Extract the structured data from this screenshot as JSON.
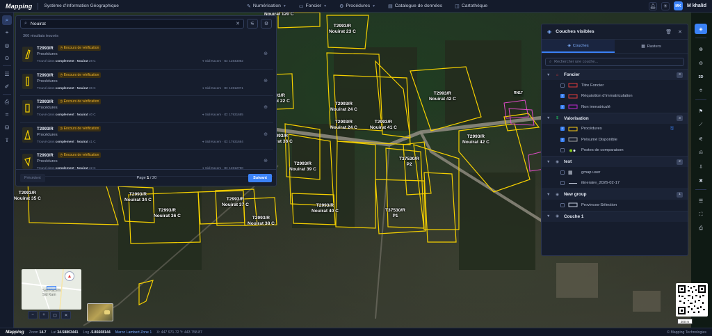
{
  "app": {
    "logo": "Mapping",
    "title": "Système d'Information Géographique"
  },
  "nav": [
    {
      "label": "Numérisation",
      "icon": "pen-icon",
      "has_dropdown": true
    },
    {
      "label": "Foncier",
      "icon": "folder-icon",
      "has_dropdown": true
    },
    {
      "label": "Procédures",
      "icon": "gear-icon",
      "has_dropdown": true
    },
    {
      "label": "Catalogue de données",
      "icon": "catalog-icon",
      "has_dropdown": false
    },
    {
      "label": "Cartothèque",
      "icon": "map-book-icon",
      "has_dropdown": false
    }
  ],
  "user": {
    "initials": "MK",
    "name": "M khalid"
  },
  "search": {
    "query": "Nouirat",
    "result_count": "366 résultats trouvés",
    "results": [
      {
        "title": "T2993/R",
        "badge": "Encours de vérification",
        "type": "Procédures",
        "found_in": "Trouvé dans",
        "field": "complement",
        "match": "Nouirat",
        "rest": "28 C",
        "location": "Sidi Kacem",
        "id": "ID: 12843082"
      },
      {
        "title": "T2993/R",
        "badge": "Encours de vérification",
        "type": "Procédures",
        "found_in": "Trouvé dans",
        "field": "complement",
        "match": "Nouirat",
        "rest": "36 C",
        "location": "Sidi Kacem",
        "id": "ID: 12812071"
      },
      {
        "title": "T2993/R",
        "badge": "Encours de vérification",
        "type": "Procédures",
        "found_in": "Trouvé dans",
        "field": "complement",
        "match": "Nouirat",
        "rest": "40 C",
        "location": "Sidi Kacem",
        "id": "ID: 17931685"
      },
      {
        "title": "T2993/R",
        "badge": "Encours de vérification",
        "type": "Procédures",
        "found_in": "Trouvé dans",
        "field": "complement",
        "match": "Nouirat",
        "rest": "41 C",
        "location": "Sidi Kacem",
        "id": "ID: 17931684"
      },
      {
        "title": "T2993/R",
        "badge": "Encours de vérification",
        "type": "Procédures",
        "found_in": "Trouvé dans",
        "field": "complement",
        "match": "Nouirat",
        "rest": "42 C",
        "location": "Sidi Kacem",
        "id": "ID: 12812790"
      }
    ],
    "pager": {
      "prev": "Précédent",
      "page_word": "Page",
      "current": "1",
      "total": "/ 20",
      "next": "Suivant"
    }
  },
  "layers": {
    "title": "Couches visibles",
    "tabs": [
      "Couches",
      "Rasters"
    ],
    "search_placeholder": "Rechercher une couche...",
    "groups": [
      {
        "name": "Foncier",
        "count": "3",
        "icon_color": "#e23b3b",
        "items": [
          {
            "name": "Titre Foncier",
            "checked": false,
            "color": "#e23b3b"
          },
          {
            "name": "Réquisition d'immatriculation",
            "checked": true,
            "color": "#e23b3b"
          },
          {
            "name": "Non immatriculé",
            "checked": true,
            "color": "#c026d3"
          }
        ]
      },
      {
        "name": "Valorisation",
        "count": "3",
        "icon_color": "#22c55e",
        "items": [
          {
            "name": "Procédures",
            "checked": true,
            "color": "#facc15"
          },
          {
            "name": "Présumé Disponible",
            "checked": true,
            "color": "#a3a3a3"
          },
          {
            "name": "Postes de comparaison",
            "checked": false,
            "color": "#84cc16"
          }
        ]
      },
      {
        "name": "test",
        "count": "2",
        "icon_color": "#8a96b3",
        "items": [
          {
            "name": "gmap user",
            "checked": false,
            "color": "#c7cede"
          },
          {
            "name": "itineraire_2026-02-17",
            "checked": false,
            "color": "#c7cede"
          }
        ]
      },
      {
        "name": "New group",
        "count": "1",
        "icon_color": "#8a96b3",
        "items": [
          {
            "name": "Provinces-Sélection",
            "checked": false,
            "color": "#c7cede"
          }
        ]
      },
      {
        "name": "Couche 1",
        "count": "",
        "icon_color": "#8a96b3",
        "items": []
      }
    ]
  },
  "parcels": [
    "T2993/R Nouirat 23 C",
    "T2993/R Nouirat 22 C",
    "T2993/R Nouirat 24 C",
    "T2993/R Nouirat 24 C",
    "T2993/R Nouirat 41 C",
    "T2993/R Nouirat 42 C",
    "T2993/R Nouirat 42 C",
    "T2993/R Nouirat 36 C",
    "T2993/R Nouirat 39 C",
    "T37530/R P2",
    "T2993/R Nouirat 35 C",
    "T2993/R Nouirat 34 C",
    "T2993/R Nouirat 36 C",
    "T2993/R Nouirat 37 C",
    "T2993/R Nouirat 40 C",
    "T37530/R P1",
    "T2993/R Nouirat 38 C",
    "Nouirat 120 C"
  ],
  "road_label": "RN17",
  "minimap": {
    "place": "Sidi Kacem\nSid Kam"
  },
  "scale": "200 m",
  "status": {
    "logo": "Mapping",
    "zoom_label": "Zoom",
    "zoom": "14.7",
    "lat_label": "Lat",
    "lat": "34.58803441",
    "lng_label": "Lng",
    "lng": "-5.86608144",
    "projection": "Maroc Lambert Zone 1",
    "xy": "X: 447 971.72  Y: 443 758.87",
    "copyright": "© Mapping Technologies"
  }
}
